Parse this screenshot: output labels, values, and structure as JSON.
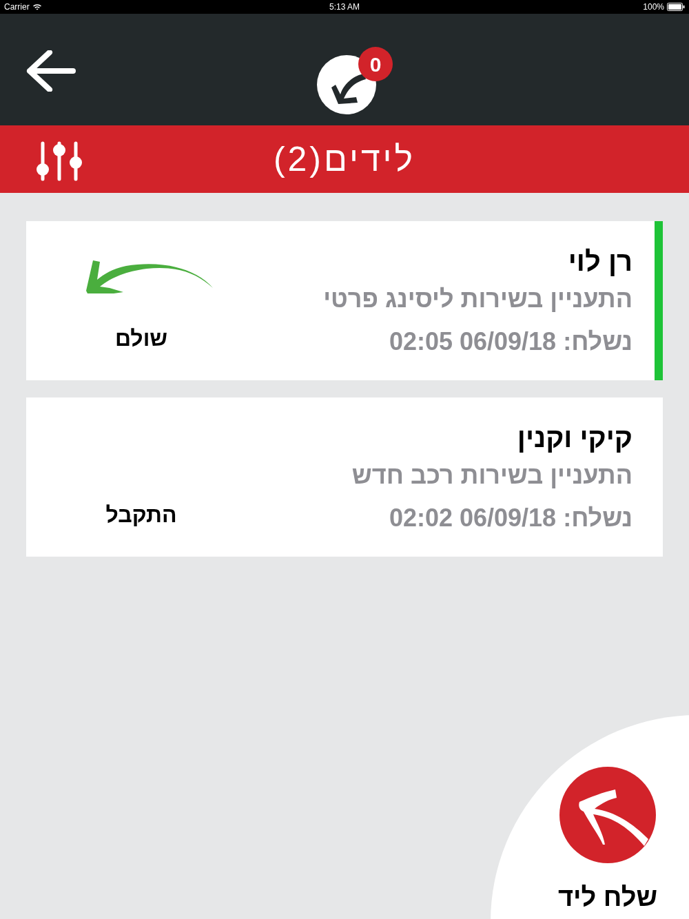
{
  "status_bar": {
    "carrier": "Carrier",
    "time": "5:13 AM",
    "battery": "100%"
  },
  "header": {
    "badge": "0"
  },
  "title_bar": {
    "title": "לידים(2)"
  },
  "leads": [
    {
      "name": "רן לוי",
      "description": "התעניין בשירות ליסינג פרטי",
      "sent": "נשלח: 06/09/18 02:05",
      "status": "שולם",
      "kind": "paid",
      "highlighted": true
    },
    {
      "name": "קיקי וקנין",
      "description": "התעניין בשירות רכב חדש",
      "sent": "נשלח: 06/09/18 02:02",
      "status": "התקבל",
      "kind": "received",
      "highlighted": false
    }
  ],
  "send_button": {
    "label": "שלח ליד"
  }
}
